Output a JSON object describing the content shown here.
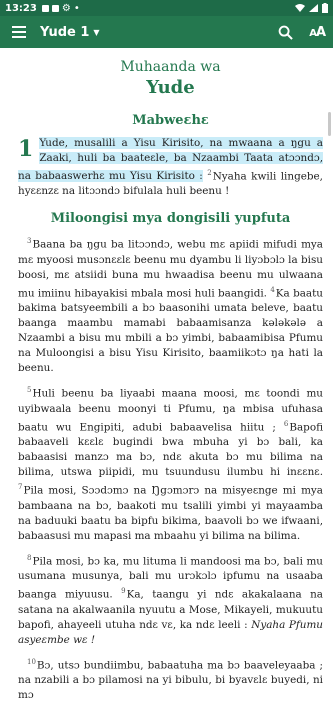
{
  "status": {
    "time": "13:23"
  },
  "toolbar": {
    "book_chapter": "Yude 1",
    "search_icon": "search-icon",
    "text_size_label": "AA"
  },
  "book": {
    "title_line1": "Muhaanda wa",
    "title_line2": "Yude"
  },
  "section1": {
    "heading": "Mabweɛhɛ"
  },
  "chapter": {
    "number": "1"
  },
  "v1": {
    "text_highlighted": "Yude, musalili a Yisu Kirisito, na mwaana a ŋgu a Zaaki, huli ba baateɛle, ba Nzaambi Taata atɔɔndɔ, na babaaswerhɛ mu Yisu Kirisito :",
    "num2": "2",
    "text2": "Nyaha kwili lingebe, hyɛɛnzɛ na litɔɔndɔ bifulala huli beenu !"
  },
  "section2": {
    "heading": "Miloongisi mya dongisili yupfuta"
  },
  "p1": {
    "num3": "3",
    "text3": "Baana ba ŋgu ba litɔɔndɔ, webu mɛ apiidi mifudi mya mɛ myoosi musɔnɛɛlɛ beenu mu dyambu li liyɔbɔlɔ la bisu boosi, mɛ atsiidi buna mu hwaadisa beenu mu ulwaana mu imiinu hibayakisi mbala mosi huli baangidi.",
    "num4": "4",
    "text4": "Ka baatu bakima batsyeembili a bɔ baasonihi umata beleve, baatu baanga maambu mamabi babaamisanza kələkələ a Nzaambi a bisu mu mbili a bɔ yimbi, babaamibisa Pfumu na Muloongisi a bisu Yisu Kirisito, baamiikɔtɔ ŋa hati la beenu."
  },
  "p2": {
    "num5": "5",
    "text5": "Huli beenu ba liyaabi maana moosi, mɛ toondi mu uyibwaala beenu moonyi ti Pfumu, ŋa mbisa ufuhasa baatu wu Engipiti, adubi babaavelisa hiitu ;",
    "num6": "6",
    "text6": "Bapofi babaaveli kɛɛlɛ bugindi bwa mbuha yi bɔ bali, ka babaasisi manzɔ ma bɔ, ndɛ akuta bɔ mu bilima na bilima, utswa piipidi, mu tsuundusu ilumbu hi inɛɛnɛ.",
    "num7": "7",
    "text7": "Pila mosi, Sɔɔdɔmɔ na Ŋgɔmɔrɔ na misyeɛnge mi mya bambaana na bɔ, baakoti mu tsalili yimbi yi mayaamba na baduuki baatu ba bipfu bikima, baavoli bɔ we ifwaani, babaasusi mu mapasi ma mbaahu yi bilima na bilima."
  },
  "p3": {
    "num8": "8",
    "text8": "Pila mosi, bɔ ka, mu lituma li mandoosi ma bɔ, bali mu usumana musunya, bali mu urɔkɔlɔ ipfumu na usaaba baanga miyuusu.",
    "num9": "9",
    "text9": "Ka, taangu yi ndɛ akakalaana na satana na akalwaanila nyuutu a Mose, Mikayeli, mukuutu bapofi, ahayeeli utuha ndɛ vɛ, ka ndɛ leeli :",
    "text9_italic": "Nyaha Pfumu asyeɛmbe wɛ !"
  },
  "p4": {
    "num10": "10",
    "text10": "Bɔ, utsɔ bundiimbu, babaatuha ma bɔ baaveleyaaba ; na nzabili a bɔ pilamosi na yi bibulu, bi byavɛlɛ buyedi, ni mɔ"
  }
}
